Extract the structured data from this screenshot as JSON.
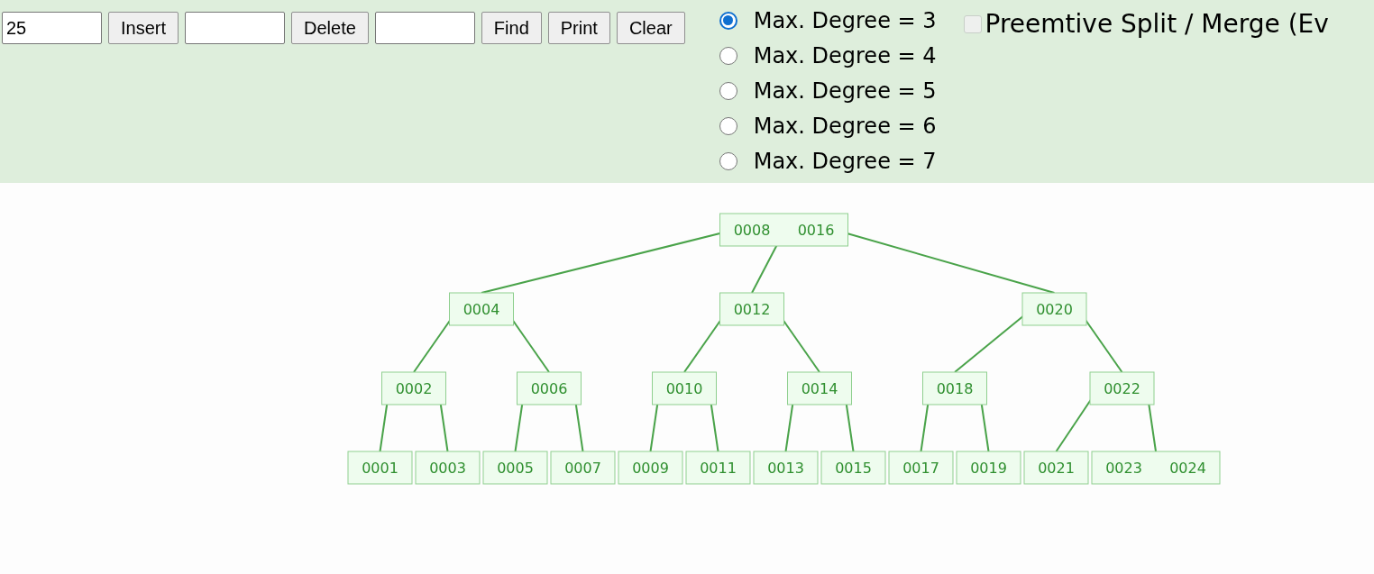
{
  "controls": {
    "fields": [
      {
        "value": "25",
        "button": "Insert"
      },
      {
        "button": "Delete"
      },
      {
        "button": "Find"
      }
    ],
    "buttons": [
      "Print",
      "Clear"
    ],
    "degrees": [
      {
        "label": "Max. Degree = 3",
        "selected": true
      },
      {
        "label": "Max. Degree = 4",
        "selected": false
      },
      {
        "label": "Max. Degree = 5",
        "selected": false
      },
      {
        "label": "Max. Degree = 6",
        "selected": false
      },
      {
        "label": "Max. Degree = 7",
        "selected": false
      }
    ],
    "preemptive": {
      "label": "Preemtive Split / Merge (Ev",
      "checked": false
    }
  },
  "tree": {
    "keys": [
      "0008",
      "0016"
    ],
    "children": [
      {
        "keys": [
          "0004"
        ],
        "children": [
          {
            "keys": [
              "0002"
            ],
            "children": [
              {
                "keys": [
                  "0001"
                ]
              },
              {
                "keys": [
                  "0003"
                ]
              }
            ]
          },
          {
            "keys": [
              "0006"
            ],
            "children": [
              {
                "keys": [
                  "0005"
                ]
              },
              {
                "keys": [
                  "0007"
                ]
              }
            ]
          }
        ]
      },
      {
        "keys": [
          "0012"
        ],
        "children": [
          {
            "keys": [
              "0010"
            ],
            "children": [
              {
                "keys": [
                  "0009"
                ]
              },
              {
                "keys": [
                  "0011"
                ]
              }
            ]
          },
          {
            "keys": [
              "0014"
            ],
            "children": [
              {
                "keys": [
                  "0013"
                ]
              },
              {
                "keys": [
                  "0015"
                ]
              }
            ]
          }
        ]
      },
      {
        "keys": [
          "0020"
        ],
        "children": [
          {
            "keys": [
              "0018"
            ],
            "children": [
              {
                "keys": [
                  "0017"
                ]
              },
              {
                "keys": [
                  "0019"
                ]
              }
            ]
          },
          {
            "keys": [
              "0022"
            ],
            "children": [
              {
                "keys": [
                  "0021"
                ]
              },
              {
                "keys": [
                  "0023",
                  "0024"
                ]
              }
            ]
          }
        ]
      }
    ]
  }
}
